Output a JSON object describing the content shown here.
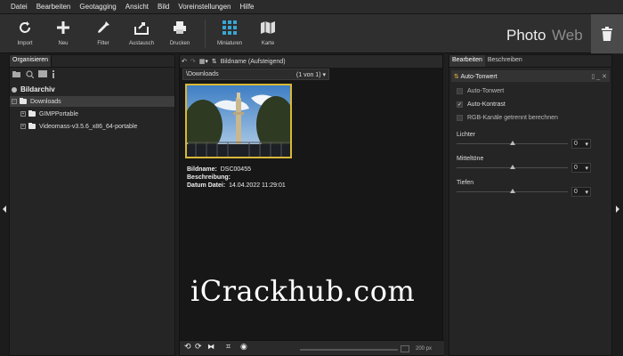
{
  "menu": [
    "Datei",
    "Bearbeiten",
    "Geotagging",
    "Ansicht",
    "Bild",
    "Voreinstellungen",
    "Hilfe"
  ],
  "toolbar": {
    "import": "Import",
    "new": "Neu",
    "filter": "Filter",
    "exchange": "Austausch",
    "print": "Drucken",
    "thumbnails": "Miniaturen",
    "map": "Karte",
    "mode_photo": "Photo",
    "mode_web": "Web"
  },
  "left": {
    "tab": "Organisieren",
    "root": "Bildarchiv",
    "items": [
      "Downloads",
      "GIMPPortable",
      "Videomass-v3.5.6_x86_64-portable"
    ]
  },
  "center": {
    "sort": "Bildname (Aufsteigend)",
    "path": "\\Downloads",
    "count": "(1 von 1)",
    "meta_name_label": "Bildname:",
    "meta_name_value": "DSC00455",
    "meta_desc_label": "Beschreibung:",
    "meta_date_label": "Datum Datei:",
    "meta_date_value": "14.04.2022 11:29:01",
    "zoom": "200 px"
  },
  "right": {
    "tabs": [
      "Bearbeiten",
      "Beschreiben"
    ],
    "panel_title": "Auto-Tonwert",
    "checks": [
      {
        "label": "Auto-Tonwert",
        "checked": false
      },
      {
        "label": "Auto-Kontrast",
        "checked": true
      },
      {
        "label": "RGB-Kanäle getrennt berechnen",
        "checked": false
      }
    ],
    "sliders": [
      {
        "label": "Lichter",
        "value": "0"
      },
      {
        "label": "Mitteltöne",
        "value": "0"
      },
      {
        "label": "Tiefen",
        "value": "0"
      }
    ]
  },
  "watermark": "iCrackhub.com"
}
